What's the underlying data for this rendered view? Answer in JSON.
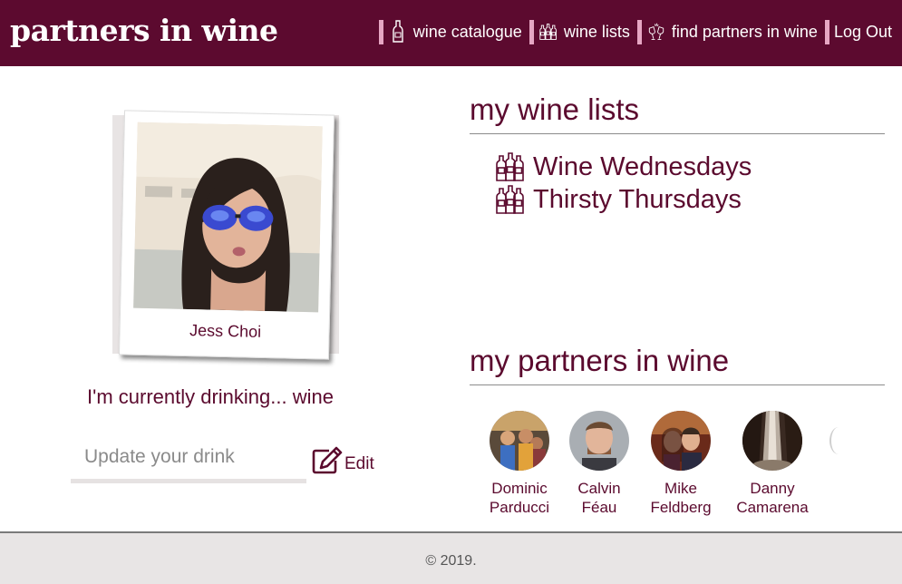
{
  "header": {
    "brand": "partners in wine",
    "nav": [
      {
        "label": "wine catalogue",
        "icon": "wine-bottle-icon"
      },
      {
        "label": "wine lists",
        "icon": "wine-bottles-icon"
      },
      {
        "label": "find partners in wine",
        "icon": "cheers-glasses-icon"
      },
      {
        "label": "Log Out"
      }
    ]
  },
  "profile": {
    "name": "Jess Choi",
    "currently_drinking": "I'm currently drinking... wine",
    "drink_input_placeholder": "Update your drink",
    "edit_label": "Edit"
  },
  "wine_lists": {
    "title": "my wine lists",
    "items": [
      {
        "label": "Wine Wednesdays",
        "icon": "wine-bottles-icon"
      },
      {
        "label": "Thirsty Thursdays",
        "icon": "wine-bottles-icon"
      }
    ]
  },
  "partners": {
    "title": "my partners in wine",
    "items": [
      {
        "first": "Dominic",
        "last": "Parducci"
      },
      {
        "first": "Calvin",
        "last": "Féau"
      },
      {
        "first": "Mike",
        "last": "Feldberg"
      },
      {
        "first": "Danny",
        "last": "Camarena"
      }
    ]
  },
  "footer": {
    "copyright": "© 2019."
  },
  "colors": {
    "brand": "#5c0a2f",
    "text": "#5b0a2e",
    "accent": "#e6a6c3",
    "footer_bg": "#e8e5e5"
  }
}
